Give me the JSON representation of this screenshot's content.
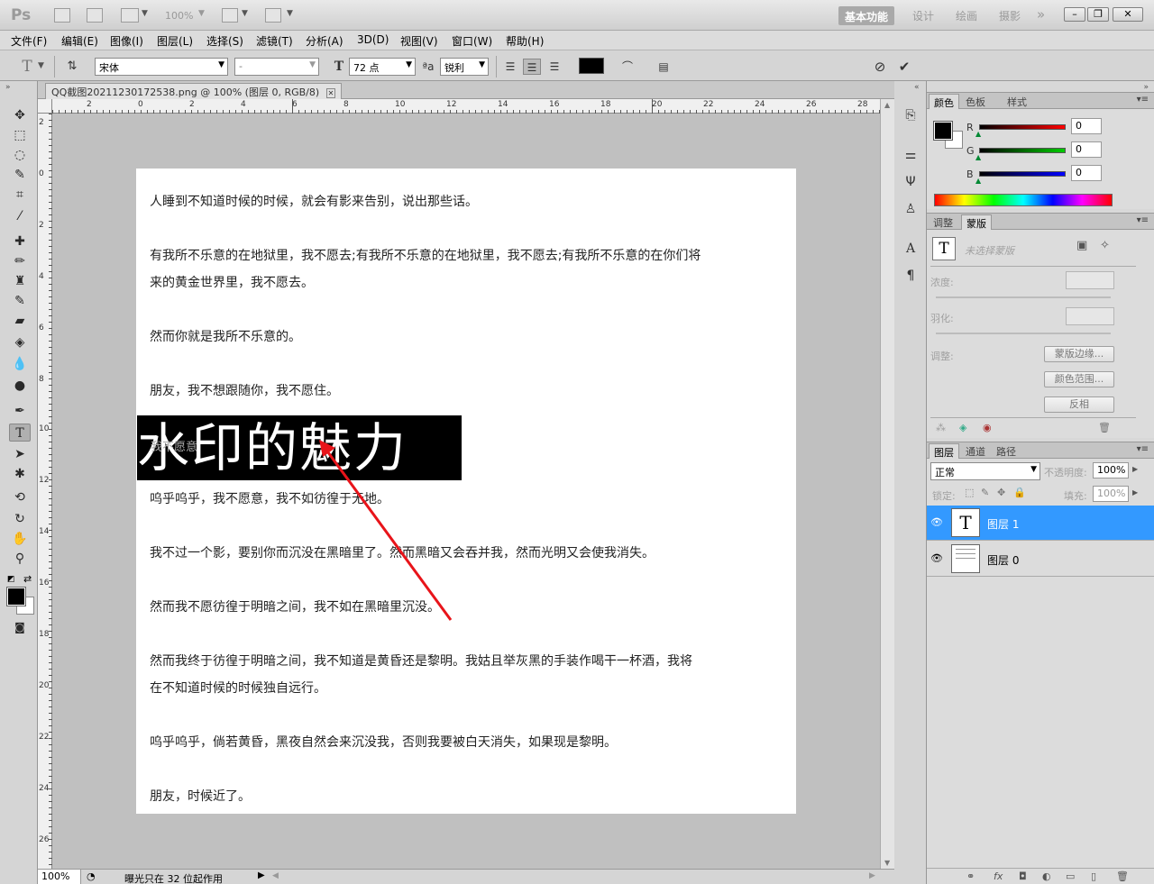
{
  "app": {
    "logo": "Ps",
    "zoom": "100%",
    "workspaces": [
      "基本功能",
      "设计",
      "绘画",
      "摄影"
    ],
    "more": "»"
  },
  "menu": [
    "文件(F)",
    "编辑(E)",
    "图像(I)",
    "图层(L)",
    "选择(S)",
    "滤镜(T)",
    "分析(A)",
    "3D(D)",
    "视图(V)",
    "窗口(W)",
    "帮助(H)"
  ],
  "options": {
    "font_family": "宋体",
    "font_style": "-",
    "font_size": "72 点",
    "aa_label": "a",
    "antialias": "锐利",
    "color": "#000000"
  },
  "document": {
    "tab_title": "QQ截图20211230172538.png @ 100% (图层 0, RGB/8)",
    "tab_close": "✕",
    "ruler_h": [
      "2",
      "0",
      "2",
      "4",
      "6",
      "8",
      "10",
      "12",
      "14",
      "16",
      "18",
      "20",
      "22",
      "24",
      "26",
      "28"
    ],
    "ruler_v": [
      "2",
      "0",
      "2",
      "4",
      "6",
      "8",
      "10",
      "12",
      "14",
      "16",
      "18",
      "20",
      "22",
      "24",
      "26"
    ],
    "paragraphs": [
      "人睡到不知道时候的时候，就会有影来告别，说出那些话。",
      "有我所不乐意的在地狱里，我不愿去;有我所不乐意的在地狱里，我不愿去;有我所不乐意的在你们将",
      "来的黄金世界里，我不愿去。",
      "然而你就是我所不乐意的。",
      "朋友，我不想跟随你，我不愿住。",
      "呜乎呜乎，我不愿意，我不如彷徨于无地。",
      "我不过一个影，要别你而沉没在黑暗里了。然而黑暗又会吞并我，然而光明又会使我消失。",
      "然而我不愿彷徨于明暗之间，我不如在黑暗里沉没。",
      "然而我终于彷徨于明暗之间，我不知道是黄昏还是黎明。我姑且举灰黑的手装作喝干一杯酒，我将",
      "在不知道时候的时候独自远行。",
      "呜乎呜乎，倘若黄昏，黑夜自然会来沉没我，否则我要被白天消失，如果现是黎明。",
      "朋友，时候近了。"
    ],
    "hidden_line": "我不愿意",
    "watermark": "水印的魅力"
  },
  "status": {
    "zoom": "100%",
    "info": "曝光只在 32 位起作用"
  },
  "color_panel": {
    "tabs": [
      "颜色",
      "色板",
      "样式"
    ],
    "channels": [
      {
        "label": "R",
        "value": "0"
      },
      {
        "label": "G",
        "value": "0"
      },
      {
        "label": "B",
        "value": "0"
      }
    ]
  },
  "masks_panel": {
    "tabs": [
      "调整",
      "蒙版"
    ],
    "no_mask": "未选择蒙版",
    "density": "浓度:",
    "feather": "羽化:",
    "refine": "调整:",
    "btn_edge": "蒙版边缘...",
    "btn_range": "颜色范围...",
    "btn_invert": "反相"
  },
  "layers_panel": {
    "tabs": [
      "图层",
      "通道",
      "路径"
    ],
    "blend_mode": "正常",
    "opacity_label": "不透明度:",
    "opacity": "100%",
    "lock_label": "锁定:",
    "fill_label": "填充:",
    "fill": "100%",
    "layers": [
      {
        "name": "图层 1",
        "thumb": "T",
        "selected": true
      },
      {
        "name": "图层 0",
        "thumb": "",
        "selected": false
      }
    ],
    "footer_icons": [
      "⚭",
      "fx",
      "◘",
      "◐",
      "▭",
      "▯",
      "🗑"
    ]
  },
  "colors": {
    "selection": "#3399ff",
    "annotation_arrow": "#e8141a"
  }
}
